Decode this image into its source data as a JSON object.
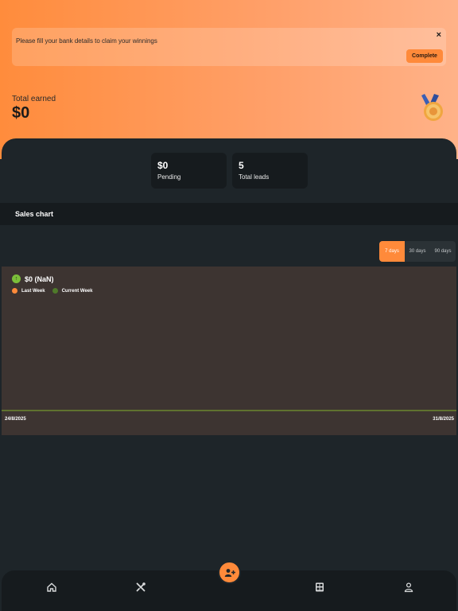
{
  "banner": {
    "message": "Please fill your bank details to claim your winnings",
    "close_label": "×",
    "button_label": "Complete"
  },
  "earnings": {
    "label": "Total earned",
    "value": "$0"
  },
  "stats": [
    {
      "value": "$0",
      "label": "Pending"
    },
    {
      "value": "5",
      "label": "Total leads"
    }
  ],
  "sales": {
    "title": "Sales chart",
    "ranges": [
      "7 days",
      "30 days",
      "90 days"
    ],
    "selected_range": "7 days",
    "total": "$0 (NaN)"
  },
  "chart_data": {
    "type": "line",
    "title": "",
    "x": [
      "24/8/2025",
      "31/8/2025"
    ],
    "series": [
      {
        "name": "Last Week",
        "values": [
          0,
          0
        ],
        "color": "#ff8a3a"
      },
      {
        "name": "Current Week",
        "values": [
          0,
          0
        ],
        "color": "#7cbf3a"
      }
    ],
    "xlabel": "",
    "ylabel": "",
    "grid": false,
    "legend": "top-left"
  },
  "colors": {
    "accent": "#ff8a3a",
    "positive": "#7cbf3a",
    "panel": "#1e2529",
    "chart_bg": "#3d3431"
  },
  "nav": {
    "items": [
      "home-icon",
      "tools-icon",
      "add-lead-icon",
      "calculator-icon",
      "profile-icon"
    ]
  }
}
